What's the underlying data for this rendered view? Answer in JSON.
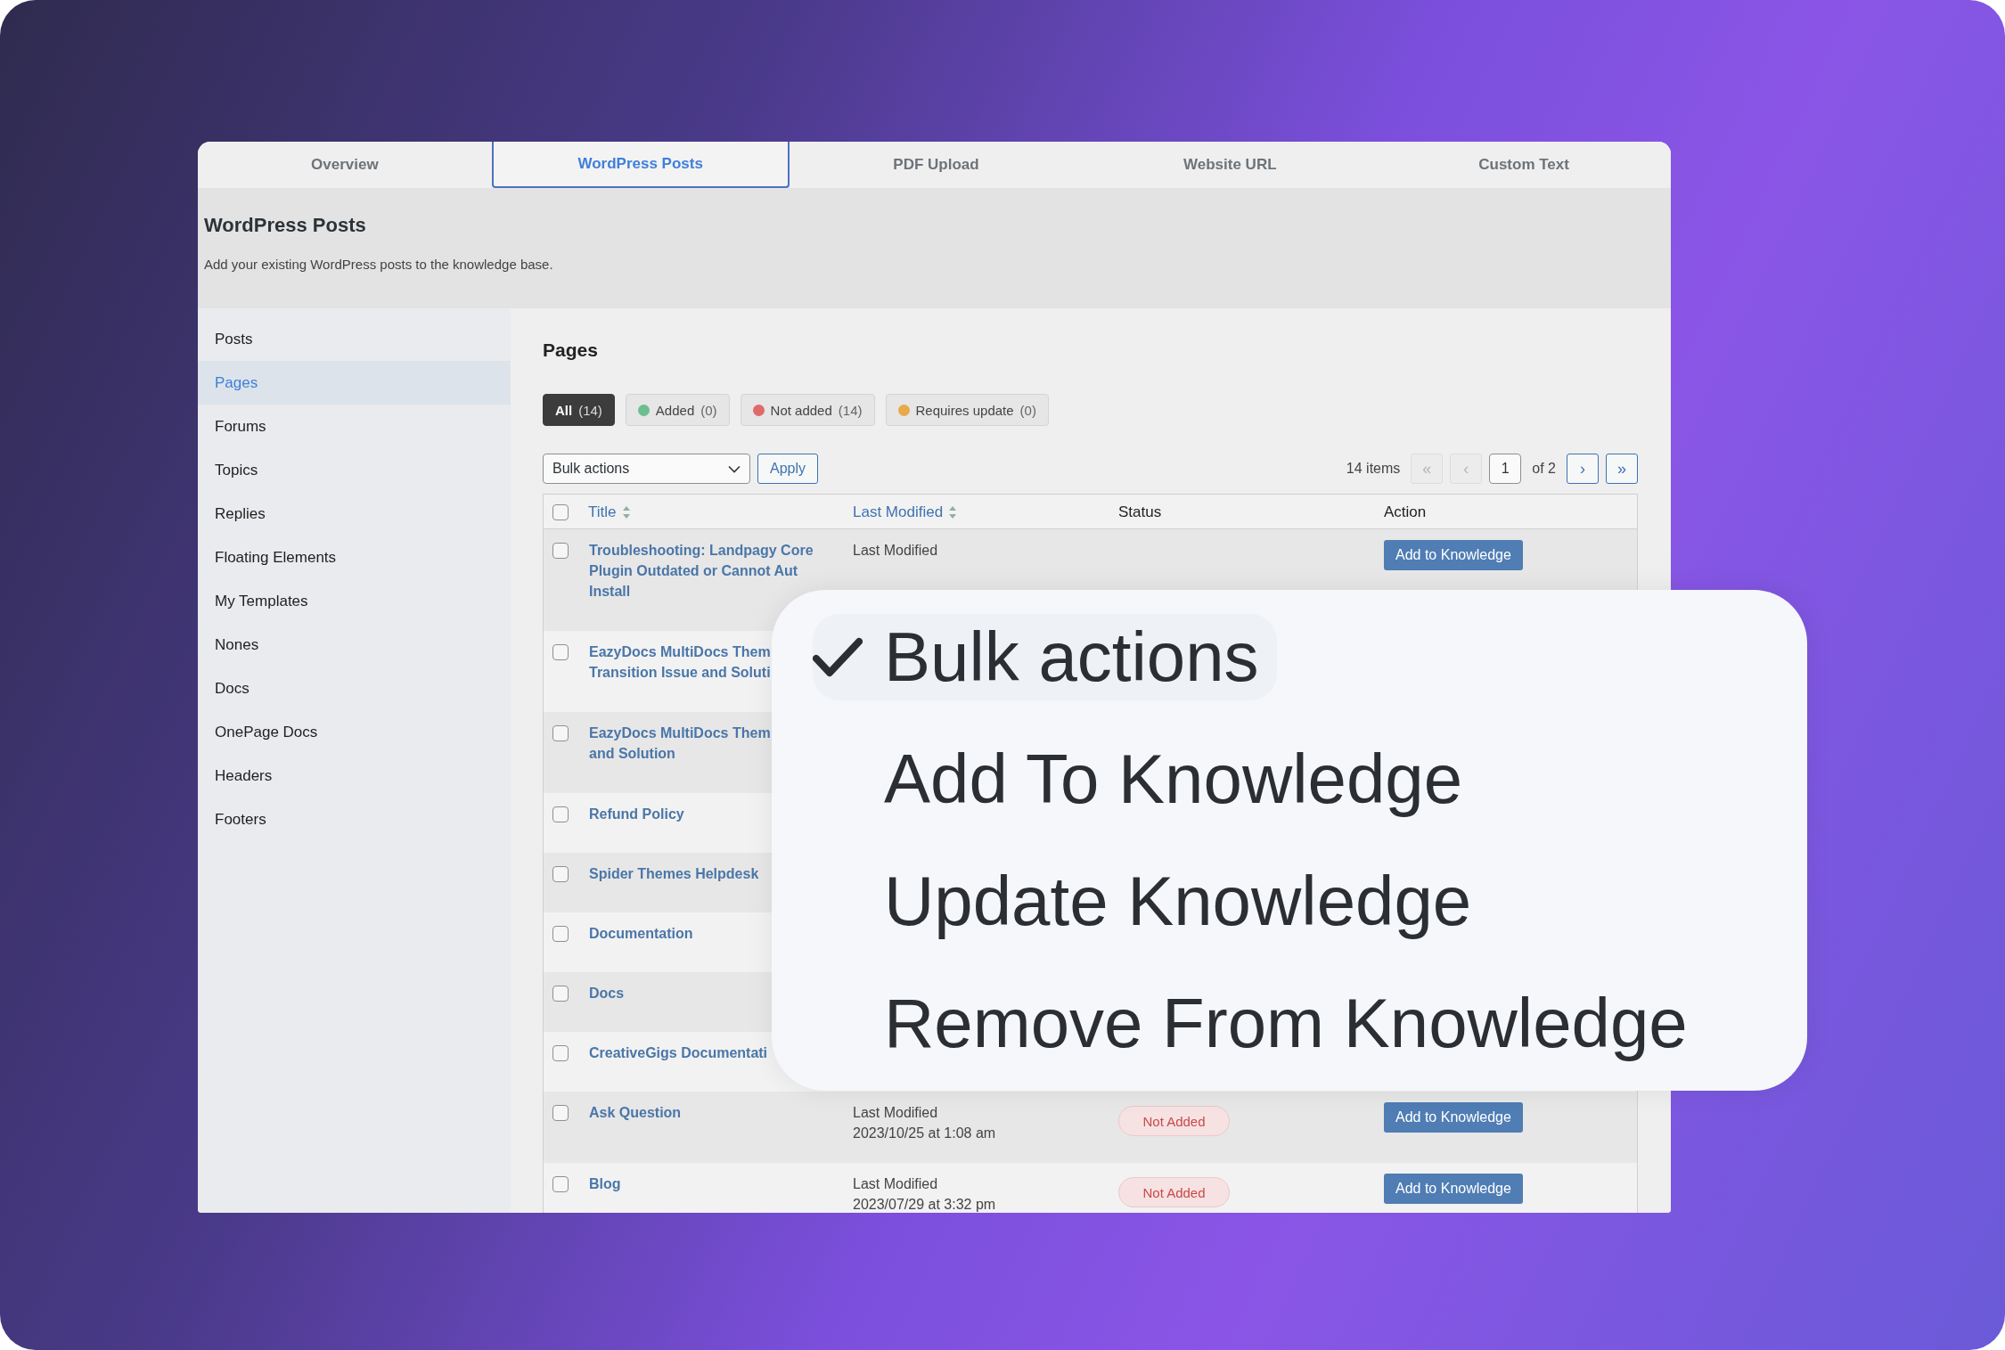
{
  "tabs": [
    {
      "label": "Overview",
      "selected": false
    },
    {
      "label": "WordPress Posts",
      "selected": true
    },
    {
      "label": "PDF Upload",
      "selected": false
    },
    {
      "label": "Website URL",
      "selected": false
    },
    {
      "label": "Custom Text",
      "selected": false
    }
  ],
  "header": {
    "title": "WordPress Posts",
    "description": "Add your existing WordPress posts to the knowledge base."
  },
  "sidebar": {
    "items": [
      {
        "label": "Posts",
        "selected": false
      },
      {
        "label": "Pages",
        "selected": true
      },
      {
        "label": "Forums",
        "selected": false
      },
      {
        "label": "Topics",
        "selected": false
      },
      {
        "label": "Replies",
        "selected": false
      },
      {
        "label": "Floating Elements",
        "selected": false
      },
      {
        "label": "My Templates",
        "selected": false
      },
      {
        "label": "Nones",
        "selected": false
      },
      {
        "label": "Docs",
        "selected": false
      },
      {
        "label": "OnePage Docs",
        "selected": false
      },
      {
        "label": "Headers",
        "selected": false
      },
      {
        "label": "Footers",
        "selected": false
      }
    ]
  },
  "content": {
    "title": "Pages",
    "filters": [
      {
        "label": "All",
        "count": "(14)",
        "selected": true
      },
      {
        "label": "Added",
        "count": "(0)",
        "color": "#6bbf8e",
        "selected": false
      },
      {
        "label": "Not added",
        "count": "(14)",
        "color": "#e06a6a",
        "selected": false
      },
      {
        "label": "Requires update",
        "count": "(0)",
        "color": "#e8a94a",
        "selected": false
      }
    ],
    "bulk_select": {
      "value": "Bulk actions"
    },
    "apply_button": "Apply",
    "pagination": {
      "items": "14 items",
      "page": "1",
      "of": "of 2",
      "buttons": [
        {
          "label": "«",
          "disabled": true,
          "kind": "first"
        },
        {
          "label": "‹",
          "disabled": true,
          "kind": "prev"
        },
        {
          "label": "›",
          "disabled": false,
          "kind": "next"
        },
        {
          "label": "»",
          "disabled": false,
          "kind": "last"
        }
      ]
    },
    "table": {
      "select_all_checked": false,
      "columns": [
        {
          "label": "Title",
          "sortable": true
        },
        {
          "label": "Last Modified",
          "sortable": true
        },
        {
          "label": "Status",
          "sortable": false
        },
        {
          "label": "Action",
          "sortable": false
        }
      ],
      "rows": [
        {
          "checked": false,
          "title_lines": [
            "Troubleshooting: Landpagy Core",
            "Plugin Outdated or Cannot Aut",
            "Install"
          ],
          "modified_lines": [
            "Last Modified"
          ],
          "action": "Add to Knowledge"
        },
        {
          "checked": false,
          "title_lines": [
            "EazyDocs MultiDocs Them",
            "Transition Issue and Soluti"
          ]
        },
        {
          "checked": false,
          "title_lines": [
            "EazyDocs MultiDocs Them",
            "and Solution"
          ]
        },
        {
          "checked": false,
          "title_lines": [
            "Refund Policy"
          ]
        },
        {
          "checked": false,
          "title_lines": [
            "Spider Themes Helpdesk"
          ]
        },
        {
          "checked": false,
          "title_lines": [
            "Documentation"
          ]
        },
        {
          "checked": false,
          "title_lines": [
            "Docs"
          ]
        },
        {
          "checked": false,
          "title_lines": [
            "CreativeGigs Documentati"
          ]
        },
        {
          "checked": false,
          "title_lines": [
            "Ask Question"
          ],
          "modified_lines": [
            "Last Modified",
            "2023/10/25 at 1:08 am"
          ],
          "status": "Not Added",
          "action": "Add to Knowledge"
        },
        {
          "checked": false,
          "title_lines": [
            "Blog"
          ],
          "modified_lines": [
            "Last Modified",
            "2023/07/29 at 3:32 pm"
          ],
          "status": "Not Added",
          "action": "Add to Knowledge"
        }
      ]
    }
  },
  "dropdown_menu": {
    "items": [
      {
        "label": "Bulk actions",
        "selected": true
      },
      {
        "label": "Add To Knowledge",
        "selected": false
      },
      {
        "label": "Update Knowledge",
        "selected": false
      },
      {
        "label": "Remove From Knowledge",
        "selected": false
      }
    ]
  }
}
